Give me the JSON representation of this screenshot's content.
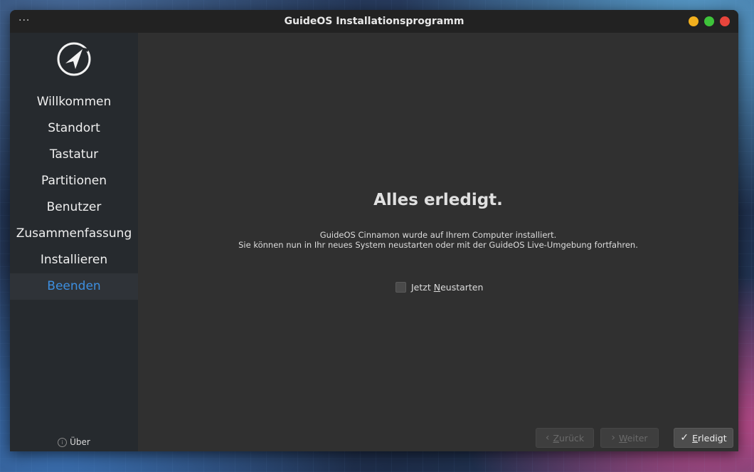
{
  "window": {
    "title": "GuideOS Installationsprogramm",
    "menu": "···"
  },
  "sidebar": {
    "steps": [
      {
        "label": "Willkommen"
      },
      {
        "label": "Standort"
      },
      {
        "label": "Tastatur"
      },
      {
        "label": "Partitionen"
      },
      {
        "label": "Benutzer"
      },
      {
        "label": "Zusammenfassung"
      },
      {
        "label": "Installieren"
      },
      {
        "label": "Beenden"
      }
    ],
    "active_step": "Beenden",
    "about_label": "Über"
  },
  "main": {
    "heading": "Alles erledigt.",
    "line1": "GuideOS Cinnamon wurde auf Ihrem Computer installiert.",
    "line2": "Sie können nun in Ihr neues System neustarten oder mit der GuideOS Live-Umgebung fortfahren.",
    "restart_checkbox": {
      "prefix": "Jetzt ",
      "mnemonic": "N",
      "suffix": "eustarten",
      "checked": false
    }
  },
  "buttons": {
    "back": {
      "mnemonic": "Z",
      "rest": "urück",
      "enabled": false
    },
    "next": {
      "mnemonic": "W",
      "rest": "eiter",
      "enabled": false
    },
    "done": {
      "mnemonic": "E",
      "rest": "rledigt",
      "enabled": true
    }
  },
  "colors": {
    "accent": "#3d8fe0",
    "close": "#e8453c",
    "minimize": "#f2b01e",
    "maximize": "#3ec33a"
  }
}
